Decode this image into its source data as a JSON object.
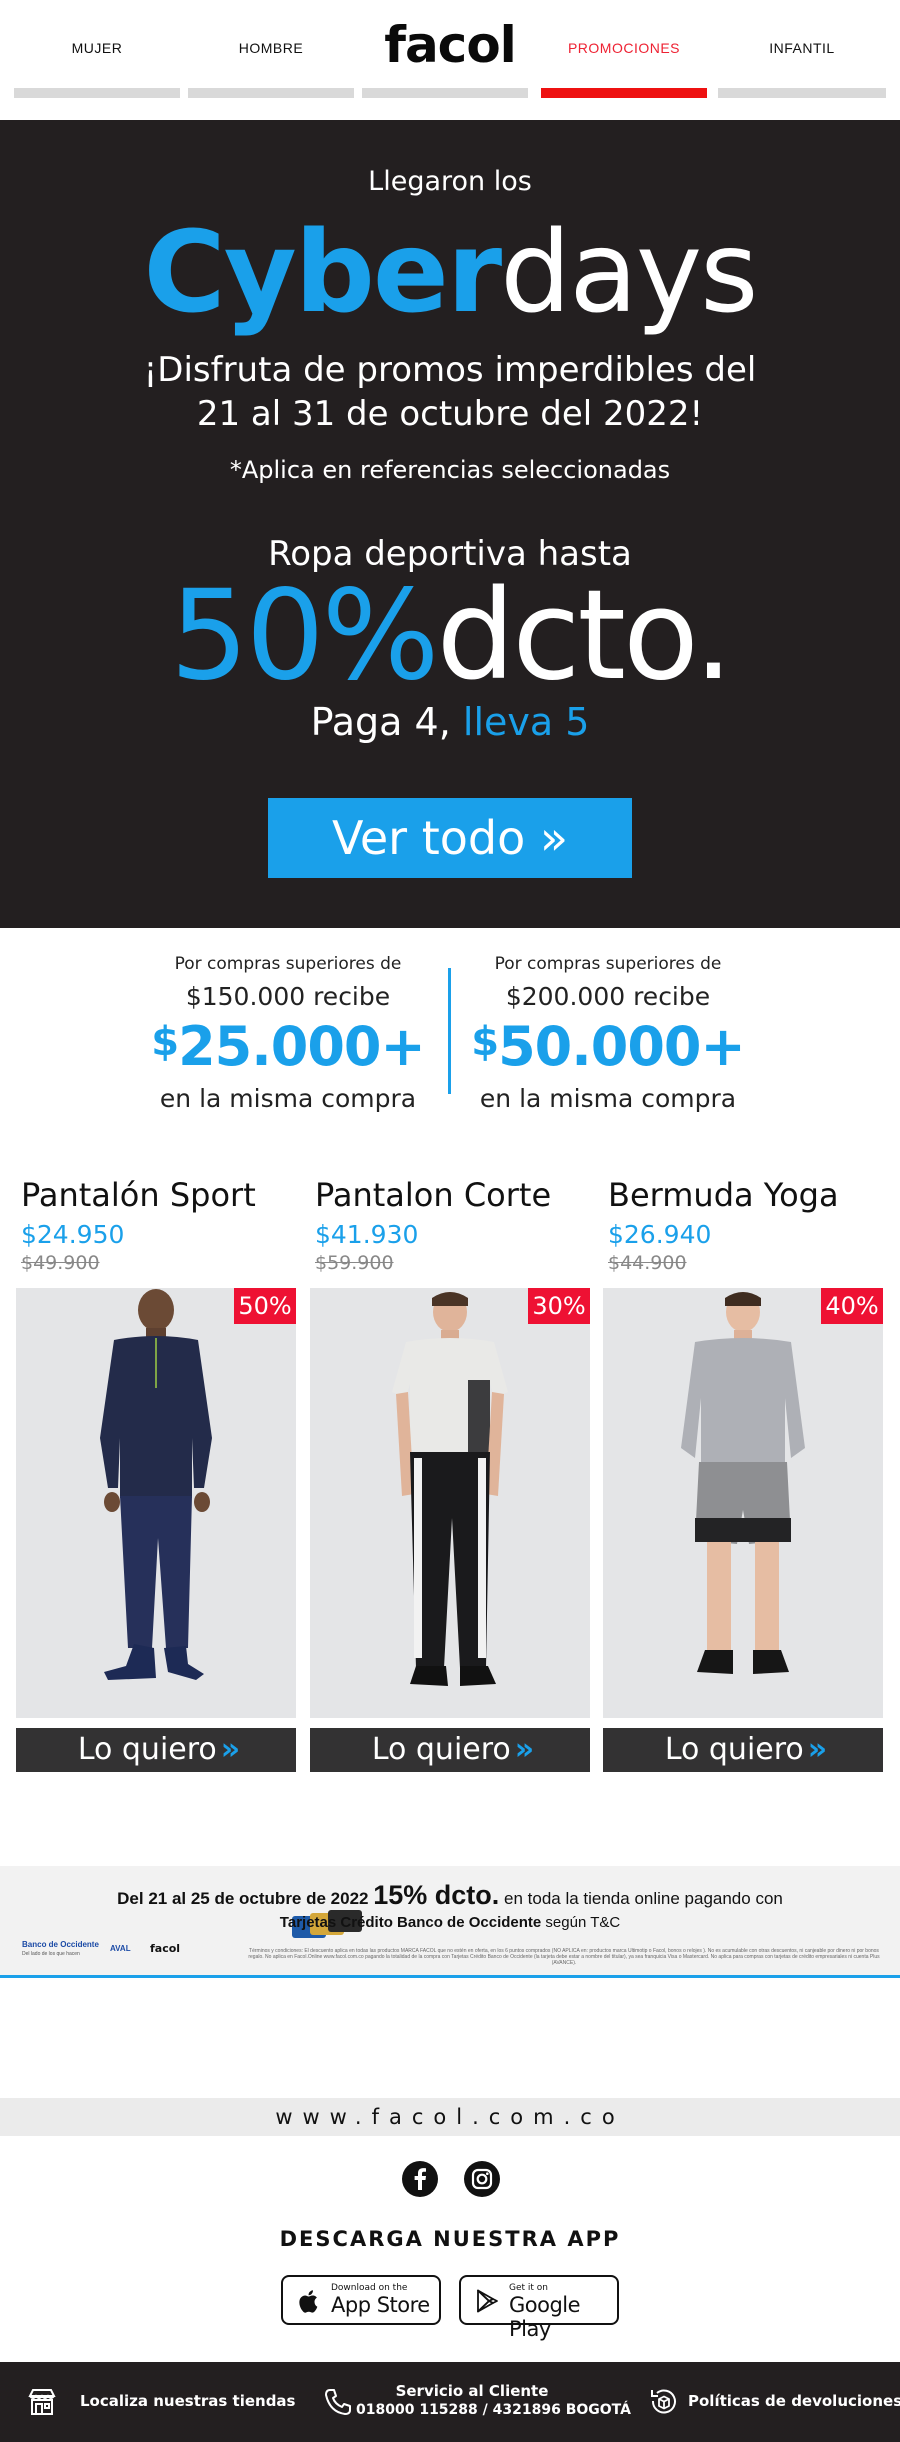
{
  "nav": {
    "items": [
      {
        "label": "MUJER"
      },
      {
        "label": "HOMBRE"
      },
      {
        "label": "PROMOCIONES"
      },
      {
        "label": "INFANTIL"
      }
    ],
    "logo": "facol"
  },
  "hero": {
    "intro": "Llegaron los",
    "title_blue": "Cyber",
    "title_white": "days",
    "subtitle_line1": "¡Disfruta de promos imperdibles del",
    "subtitle_line2": "21 al 31 de octubre del 2022!",
    "note": "*Aplica en referencias seleccionadas",
    "promo_line": "Ropa deportiva hasta",
    "discount_value": "50%",
    "discount_suffix": "dcto.",
    "pay_text": "Paga 4, ",
    "pay_blue": "lleva 5",
    "cta_label": "Ver todo »"
  },
  "offers": [
    {
      "line1": "Por compras superiores de",
      "line2": "$150.000 recibe",
      "currency": "$",
      "amount": "25.000+",
      "line4": "en la misma compra"
    },
    {
      "line1": "Por compras superiores de",
      "line2": "$200.000 recibe",
      "currency": "$",
      "amount": "50.000+",
      "line4": "en la misma compra"
    }
  ],
  "products": [
    {
      "name": "Pantalón Sport",
      "price": "$24.950",
      "old_price": "$49.900",
      "badge": "50%",
      "cta": "Lo quiero",
      "chevron": "»"
    },
    {
      "name": "Pantalon Corte",
      "price": "$41.930",
      "old_price": "$59.900",
      "badge": "30%",
      "cta": "Lo quiero",
      "chevron": "»"
    },
    {
      "name": "Bermuda Yoga",
      "price": "$26.940",
      "old_price": "$44.900",
      "badge": "40%",
      "cta": "Lo quiero",
      "chevron": "»"
    }
  ],
  "bank": {
    "date_text": "Del 21 al 25 de octubre de 2022",
    "discount": "15% dcto.",
    "rest": " en toda la tienda online pagando con",
    "cards_bold": "Tarjetas Crédito Banco de Occidente",
    "cards_rest": " según T&C",
    "terms": "Términos y condiciones: El descuento aplica en todas las productos MARCA FACOL que no estén en oferta, en los 6 puntos comprados (NO APLICA en: productos marca Ultimotip o Facol, bonos o relojes ). No es acumulable con otras descuentos, ni canjeable por dinero ni por bonos regalo. No aplica en Facol.Online www.facol.com.co pagando la totalidad de la compra con Tarjetas Crédito Banco de Occidente (la tarjeta debe estar a nombre del titular), ya sea franquicia Visa o Mastercard. No aplica para compras con tarjetas de crédito empresariales ni cuenta Plus (AVANCE).",
    "bank_name": "Banco de Occidente",
    "bank_tagline": "Del lado de los que hacen",
    "aval": "AVAL",
    "small_logo": "facol"
  },
  "footer": {
    "site": "www.facol.com.co",
    "app_title": "DESCARGA NUESTRA APP",
    "appstore_small": "Download on the",
    "appstore_big": "App Store",
    "gplay_small": "Get it on",
    "gplay_big": "Google Play",
    "stores_label": "Localiza nuestras tiendas",
    "service_label": "Servicio al Cliente",
    "service_phone": "018000 115288 / 4321896 BOGOTÁ",
    "returns_label": "Políticas de devoluciones"
  },
  "colors": {
    "accent": "#1aa0ea",
    "promo_red": "#ee1111",
    "dark": "#231f20"
  }
}
